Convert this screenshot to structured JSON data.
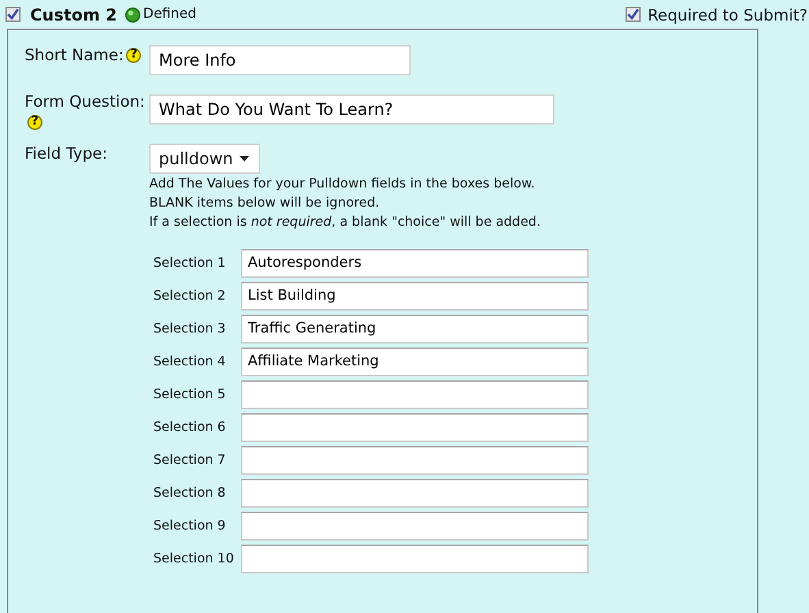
{
  "header": {
    "enabled": {
      "checked": true
    },
    "title": "Custom 2",
    "status": "Defined",
    "required": {
      "label": "Required to Submit?",
      "checked": true
    }
  },
  "fields": [
    {
      "label": "Short Name:",
      "help": "?",
      "value": "More Info",
      "kind": "short"
    },
    {
      "label": "Form Question:",
      "help": "?",
      "value": "What Do You Want To Learn?",
      "kind": "long"
    }
  ],
  "field_type": {
    "label": "Field Type:",
    "value": "pulldown"
  },
  "notes": [
    "Add The Values for your Pulldown fields in the boxes below.",
    "BLANK items below will be ignored.",
    "If a selection is *not required*, a blank \"choice\" will be added."
  ],
  "selections": [
    {
      "label": "Selection 1",
      "value": "Autoresponders"
    },
    {
      "label": "Selection 2",
      "value": "List Building"
    },
    {
      "label": "Selection 3",
      "value": "Traffic Generating"
    },
    {
      "label": "Selection 4",
      "value": "Affiliate Marketing"
    },
    {
      "label": "Selection 5"
    },
    {
      "label": "Selection 6"
    },
    {
      "label": "Selection 7"
    },
    {
      "label": "Selection 8"
    },
    {
      "label": "Selection 9"
    },
    {
      "label": "Selection 10"
    }
  ]
}
